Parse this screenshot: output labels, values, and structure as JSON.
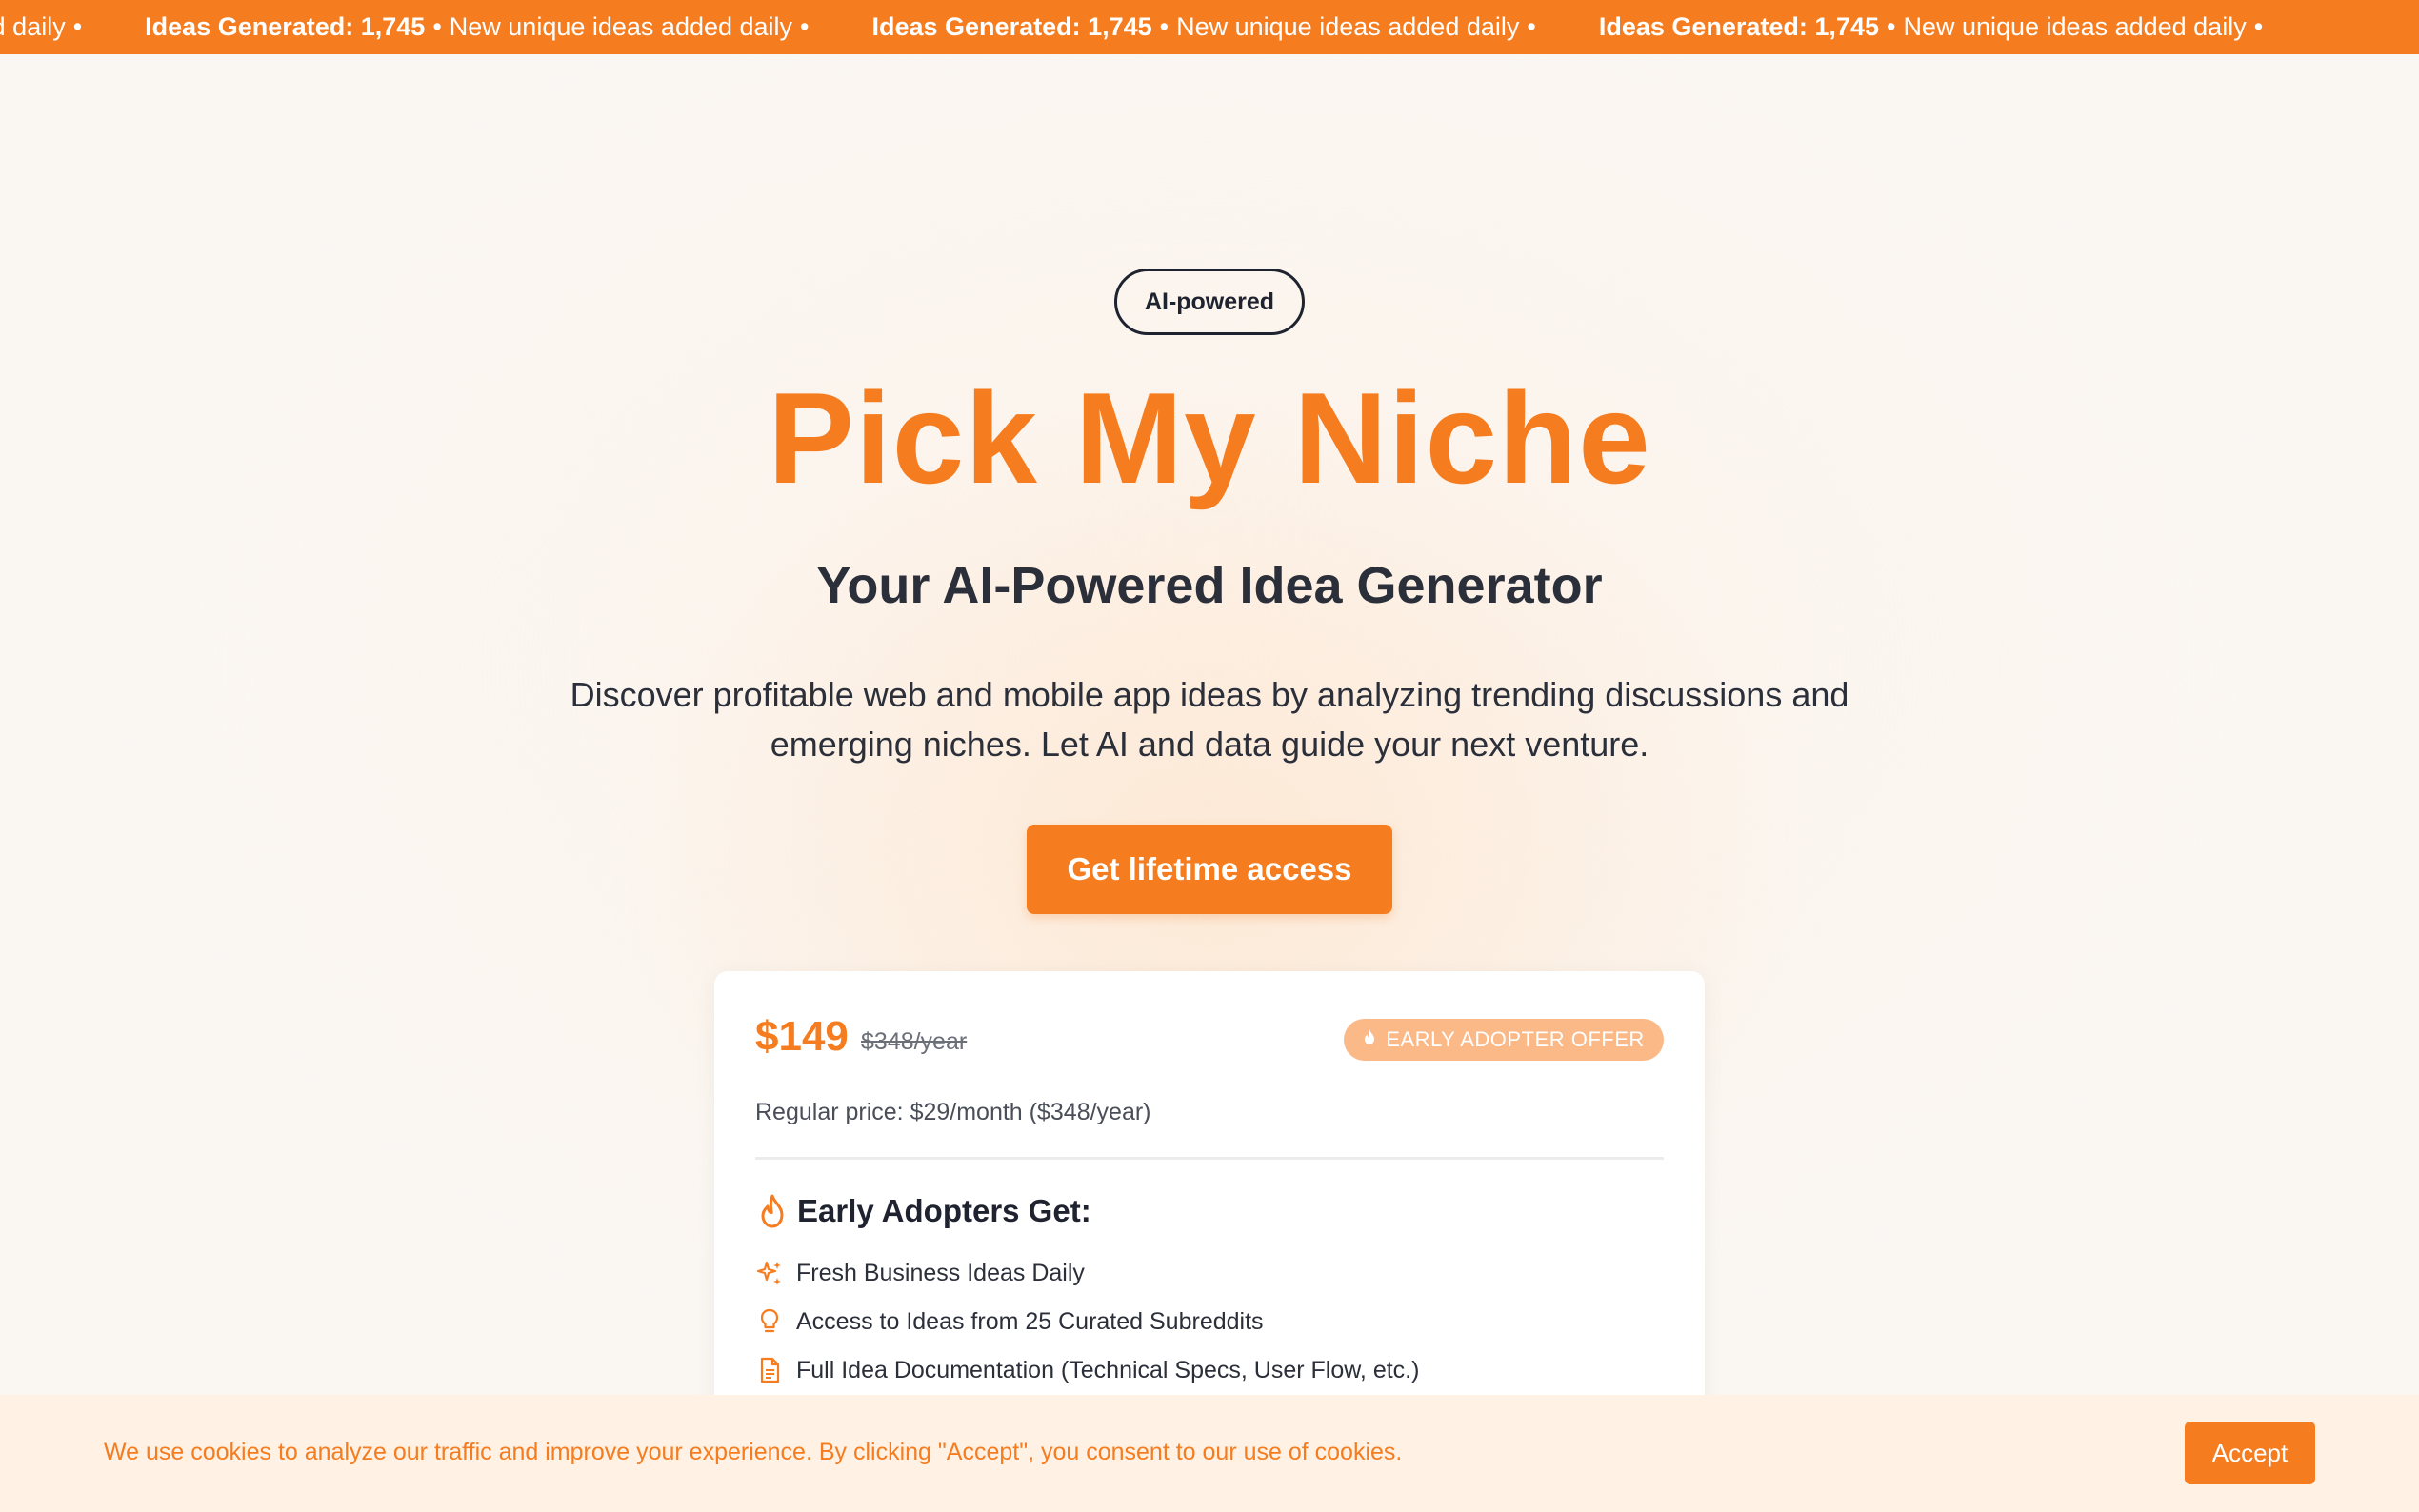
{
  "ticker": {
    "label": "Ideas Generated: 1,745",
    "message": "New unique ideas added daily",
    "separator": "•",
    "lead_fragment": "ique ideas added daily"
  },
  "hero": {
    "badge": "AI-powered",
    "title": "Pick My Niche",
    "subtitle": "Your AI-Powered Idea Generator",
    "description": "Discover profitable web and mobile app ideas by analyzing trending discussions and emerging niches. Let AI and data guide your next venture.",
    "cta": "Get lifetime access"
  },
  "pricing": {
    "price": "$149",
    "old_price": "$348/year",
    "offer_badge": "EARLY ADOPTER OFFER",
    "regular_price": "Regular price: $29/month ($348/year)",
    "perks_title": "Early Adopters Get:",
    "perks": [
      {
        "label": "Fresh Business Ideas Daily",
        "icon": "sparkles-icon"
      },
      {
        "label": "Access to Ideas from 25 Curated Subreddits",
        "icon": "lightbulb-icon"
      },
      {
        "label": "Full Idea Documentation (Technical Specs, User Flow, etc.)",
        "icon": "document-icon"
      }
    ]
  },
  "cookie": {
    "text": "We use cookies to analyze our traffic and improve your experience. By clicking \"Accept\", you consent to our use of cookies.",
    "accept": "Accept"
  },
  "colors": {
    "brand": "#f57c1f",
    "badge_soft": "#fbb987",
    "cookie_bg": "#fff1e4"
  }
}
